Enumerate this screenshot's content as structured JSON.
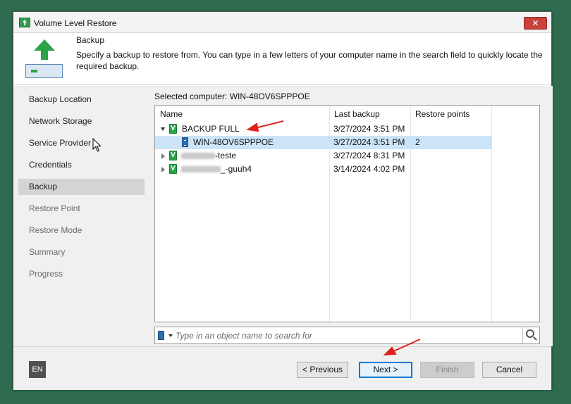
{
  "window": {
    "title": "Volume Level Restore",
    "close_label": "✕"
  },
  "header": {
    "title": "Backup",
    "description": "Specify a backup to restore from. You can type in a few letters of your computer name in the search field to quickly locate the required backup."
  },
  "sidebar": {
    "items": [
      {
        "label": "Backup Location",
        "state": "normal"
      },
      {
        "label": "Network Storage",
        "state": "normal"
      },
      {
        "label": "Service Provider",
        "state": "normal"
      },
      {
        "label": "Credentials",
        "state": "normal"
      },
      {
        "label": "Backup",
        "state": "active"
      },
      {
        "label": "Restore Point",
        "state": "disabled"
      },
      {
        "label": "Restore Mode",
        "state": "disabled"
      },
      {
        "label": "Summary",
        "state": "disabled"
      },
      {
        "label": "Progress",
        "state": "disabled"
      }
    ]
  },
  "main": {
    "selected_computer": "Selected computer: WIN-48OV6SPPPOE",
    "columns": [
      "Name",
      "Last backup",
      "Restore points"
    ],
    "rows": [
      {
        "name": "BACKUP FULL",
        "last_backup": "3/27/2024 3:51 PM",
        "restore_points": ""
      },
      {
        "name": "WIN-48OV6SPPPOE",
        "last_backup": "3/27/2024 3:51 PM",
        "restore_points": "2"
      },
      {
        "name": "-teste",
        "last_backup": "3/27/2024 8:31 PM",
        "restore_points": ""
      },
      {
        "name": "_-guuh4",
        "last_backup": "3/14/2024 4:02 PM",
        "restore_points": ""
      }
    ],
    "search_placeholder": "Type in an object name to search for"
  },
  "footer": {
    "language": "EN",
    "previous_label": "< Previous",
    "next_label": "Next >",
    "finish_label": "Finish",
    "cancel_label": "Cancel"
  },
  "colors": {
    "accent_green": "#2aa34a",
    "selection_blue": "#cce4f7",
    "annotation_red": "#e0201e",
    "desktop_bg": "#2e6b4f"
  }
}
